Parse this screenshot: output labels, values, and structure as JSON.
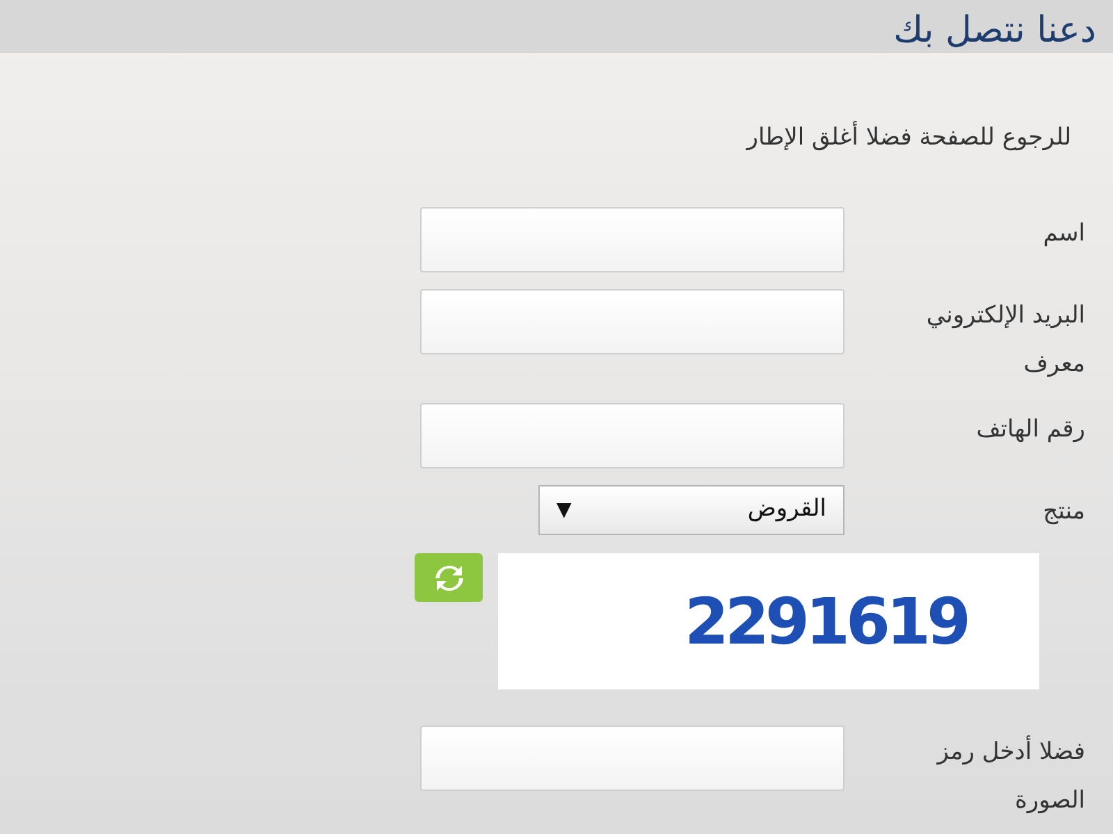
{
  "header": {
    "title": "دعنا نتصل بك"
  },
  "intro": "للرجوع للصفحة فضلا أغلق الإطار",
  "form": {
    "fields": [
      {
        "kind": "text",
        "label": "اسم"
      },
      {
        "kind": "text",
        "label": "البريد الإلكتروني معرف"
      },
      {
        "kind": "text",
        "label": "رقم الهاتف"
      },
      {
        "kind": "select",
        "label": "منتج",
        "value": "القروض",
        "arrow": "▼"
      },
      {
        "kind": "captcha",
        "code": "2291619"
      },
      {
        "kind": "text",
        "label": "فضلا أدخل رمز الصورة"
      }
    ]
  }
}
